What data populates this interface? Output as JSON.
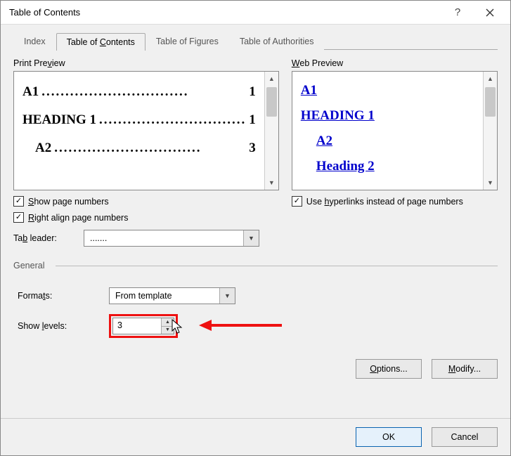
{
  "window": {
    "title": "Table of Contents"
  },
  "tabs": {
    "index": "Index",
    "toc_pre": "Table of ",
    "toc_u": "C",
    "toc_post": "ontents",
    "figures": "Table of Figures",
    "authorities": "Table of Authorities"
  },
  "print": {
    "label_pre": "Print Pre",
    "label_u": "v",
    "label_post": "iew",
    "items": [
      {
        "head": "A1",
        "page": "1",
        "level": 1
      },
      {
        "head": "HEADING 1",
        "page": "1",
        "level": 1
      },
      {
        "head": "A2",
        "page": "3",
        "level": 2
      }
    ],
    "show_pagenums_u": "S",
    "show_pagenums_post": "how page numbers",
    "right_align_u": "R",
    "right_align_post": "ight align page numbers",
    "tab_leader_lbl_pre": "Ta",
    "tab_leader_lbl_u": "b",
    "tab_leader_lbl_post": " leader:",
    "tab_leader_val": "......."
  },
  "web": {
    "label_u": "W",
    "label_post": "eb Preview",
    "items": [
      {
        "text": "A1",
        "level": 1
      },
      {
        "text": "HEADING 1",
        "level": 1
      },
      {
        "text": "A2",
        "level": 2
      },
      {
        "text": "Heading 2",
        "level": 2
      }
    ],
    "use_links_pre": "Use ",
    "use_links_u": "h",
    "use_links_post": "yperlinks instead of page numbers"
  },
  "general": {
    "title": "General",
    "formats_lbl_pre": "Forma",
    "formats_lbl_u": "t",
    "formats_lbl_post": "s:",
    "formats_val": "From template",
    "levels_lbl_pre": "Show ",
    "levels_lbl_u": "l",
    "levels_lbl_post": "evels:",
    "levels_val": "3"
  },
  "buttons": {
    "options_u": "O",
    "options_post": "ptions...",
    "modify_u": "M",
    "modify_post": "odify...",
    "ok": "OK",
    "cancel": "Cancel"
  }
}
